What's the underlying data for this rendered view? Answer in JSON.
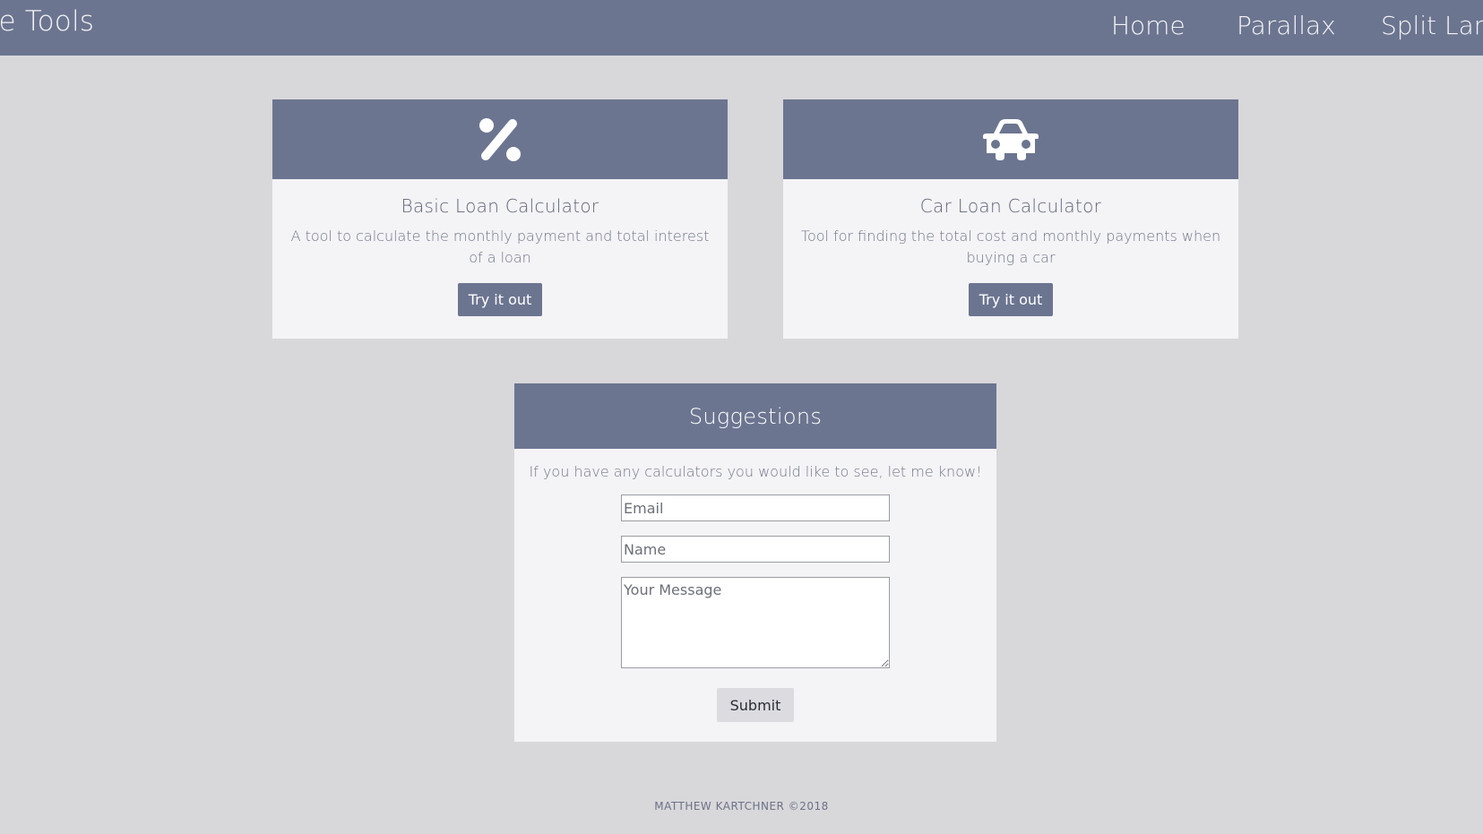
{
  "navbar": {
    "brand": "ace Tools",
    "links": [
      {
        "label": "Home"
      },
      {
        "label": "Parallax"
      },
      {
        "label": "Split Lan"
      }
    ]
  },
  "cards": [
    {
      "icon": "percent-icon",
      "title": "Basic Loan Calculator",
      "description": "A tool to calculate the monthly payment and total interest of a loan",
      "button_label": "Try it out"
    },
    {
      "icon": "car-icon",
      "title": "Car Loan Calculator",
      "description": "Tool for finding the total cost and monthly payments when buying a car",
      "button_label": "Try it out"
    }
  ],
  "suggestions": {
    "title": "Suggestions",
    "intro": "If you have any calculators you would like to see, let me know!",
    "email_placeholder": "Email",
    "name_placeholder": "Name",
    "message_placeholder": "Your Message",
    "submit_label": "Submit"
  },
  "footer": {
    "text": "MATTHEW KARTCHNER ©2018"
  },
  "colors": {
    "accent": "#6c7590",
    "background": "#d8d7da",
    "card": "#f4f3f6"
  }
}
